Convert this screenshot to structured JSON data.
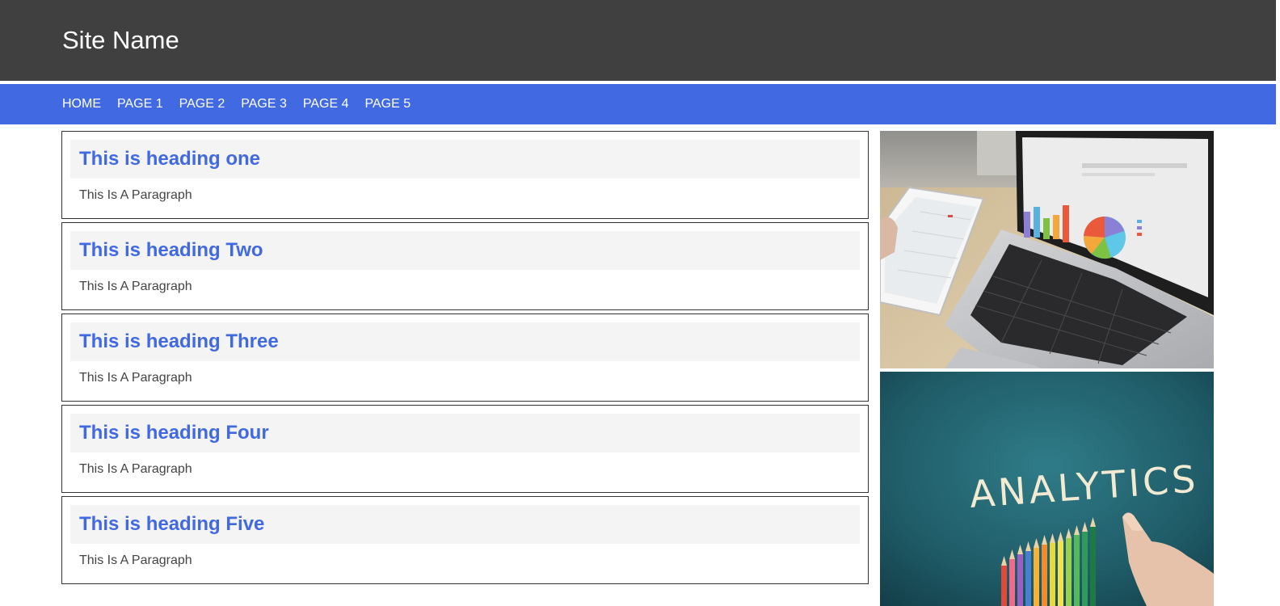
{
  "header": {
    "site_name": "Site Name"
  },
  "nav": {
    "items": [
      {
        "label": "HOME"
      },
      {
        "label": "PAGE 1"
      },
      {
        "label": "PAGE 2"
      },
      {
        "label": "PAGE 3"
      },
      {
        "label": "PAGE 4"
      },
      {
        "label": "PAGE 5"
      }
    ]
  },
  "cards": [
    {
      "heading": "This is heading one",
      "paragraph": "This Is A Paragraph"
    },
    {
      "heading": "This is heading Two",
      "paragraph": "This Is A Paragraph"
    },
    {
      "heading": "This is heading Three",
      "paragraph": "This Is A Paragraph"
    },
    {
      "heading": "This is heading Four",
      "paragraph": "This Is A Paragraph"
    },
    {
      "heading": "This is heading Five",
      "paragraph": "This Is A Paragraph"
    }
  ],
  "sidebar": {
    "analytics_word": "ANALYTICS"
  },
  "colors": {
    "header_bg": "#404040",
    "nav_bg": "#4169e1",
    "heading": "#4169e1",
    "heading_bg": "#f4f4f4",
    "paragraph": "#444444"
  }
}
